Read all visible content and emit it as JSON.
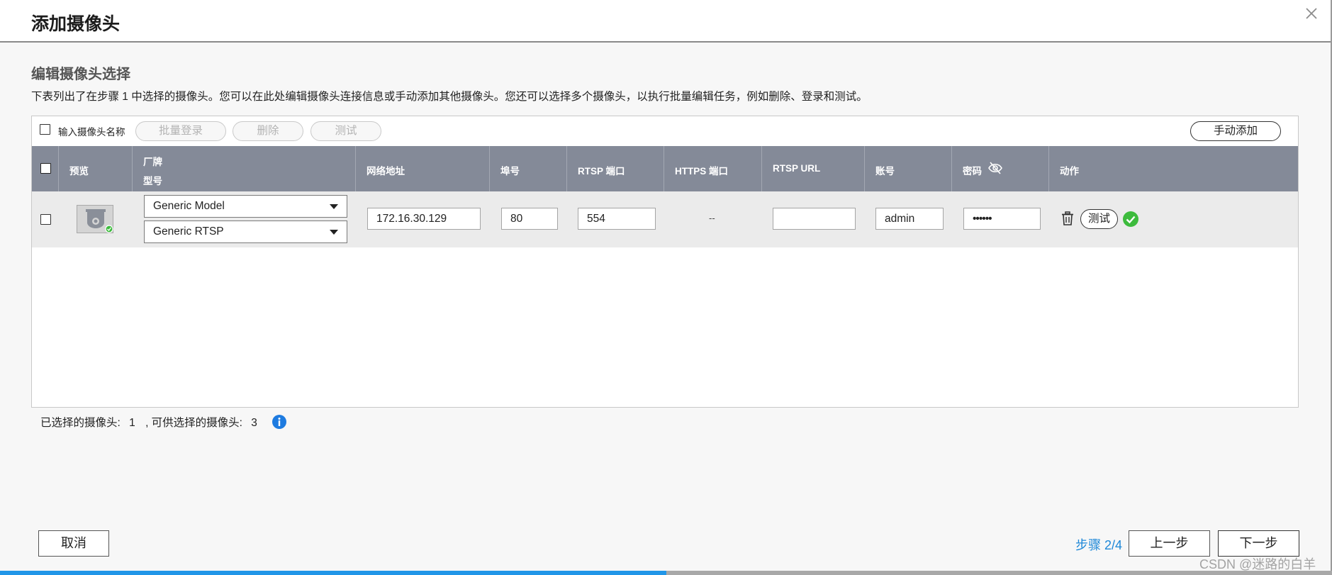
{
  "dialog": {
    "title": "添加摄像头",
    "close_icon": "close-icon"
  },
  "section": {
    "title": "编辑摄像头选择",
    "description": "下表列出了在步骤 1 中选择的摄像头。您可以在此处编辑摄像头连接信息或手动添加其他摄像头。您还可以选择多个摄像头，以执行批量编辑任务，例如删除、登录和测试。"
  },
  "toolbar": {
    "select_name_label": "输入摄像头名称",
    "batch_login": "批量登录",
    "delete": "删除",
    "test": "测试",
    "manual_add": "手动添加"
  },
  "table": {
    "headers": {
      "preview": "预览",
      "brand": "厂牌",
      "model": "型号",
      "network_address": "网络地址",
      "port": "埠号",
      "rtsp_port": "RTSP 端口",
      "https_port": "HTTPS 端口",
      "rtsp_url": "RTSP URL",
      "account": "账号",
      "password": "密码",
      "action": "动作"
    },
    "rows": [
      {
        "brand": "Generic Model",
        "model": "Generic RTSP",
        "ip": "172.16.30.129",
        "port": "80",
        "rtsp_port": "554",
        "https_port": "--",
        "rtsp_url": "",
        "account": "admin",
        "password": "••••••",
        "test_label": "测试"
      }
    ]
  },
  "footer": {
    "selected_label": "已选择的摄像头:",
    "selected_count": "1",
    "available_label": ", 可供选择的摄像头:",
    "available_count": "3",
    "cancel": "取消",
    "step": "步骤 2/4",
    "prev": "上一步",
    "next": "下一步",
    "watermark": "CSDN @迷路的白羊"
  },
  "progress": {
    "value": 0.5
  },
  "colors": {
    "accent": "#2196e8",
    "header_bg": "#848a98",
    "row_bg": "#ebebeb",
    "success": "#3dbb3d",
    "info": "#1e7be0"
  }
}
